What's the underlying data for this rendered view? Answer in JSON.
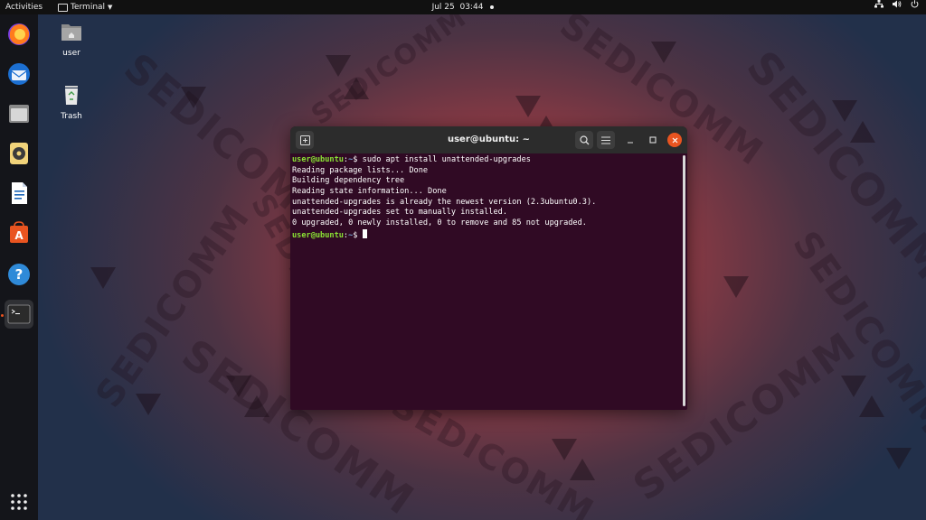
{
  "topbar": {
    "activities": "Activities",
    "app_name": "Terminal",
    "date": "Jul 25",
    "time": "03:44"
  },
  "dock": {
    "items": [
      "firefox-icon",
      "thunderbird-icon",
      "files-icon",
      "rhythmbox-icon",
      "writer-icon",
      "software-icon",
      "help-icon",
      "terminal-icon",
      "show-apps-icon"
    ]
  },
  "desktop": {
    "icons": [
      {
        "label": "user"
      },
      {
        "label": "Trash"
      }
    ]
  },
  "wallpaper": {
    "watermark": "SEDICOMM"
  },
  "terminal": {
    "title": "user@ubuntu: ~",
    "prompt_user": "user@ubuntu",
    "prompt_path": "~",
    "prompt_symbol": "$",
    "command": "sudo apt install unattended-upgrades",
    "output": [
      "Reading package lists... Done",
      "Building dependency tree",
      "Reading state information... Done",
      "unattended-upgrades is already the newest version (2.3ubuntu0.3).",
      "unattended-upgrades set to manually installed.",
      "0 upgraded, 0 newly installed, 0 to remove and 85 not upgraded."
    ]
  },
  "colors": {
    "accent": "#e95420",
    "terminal_bg": "#300a24",
    "prompt_user": "#8ae234",
    "prompt_path": "#729fcf"
  }
}
